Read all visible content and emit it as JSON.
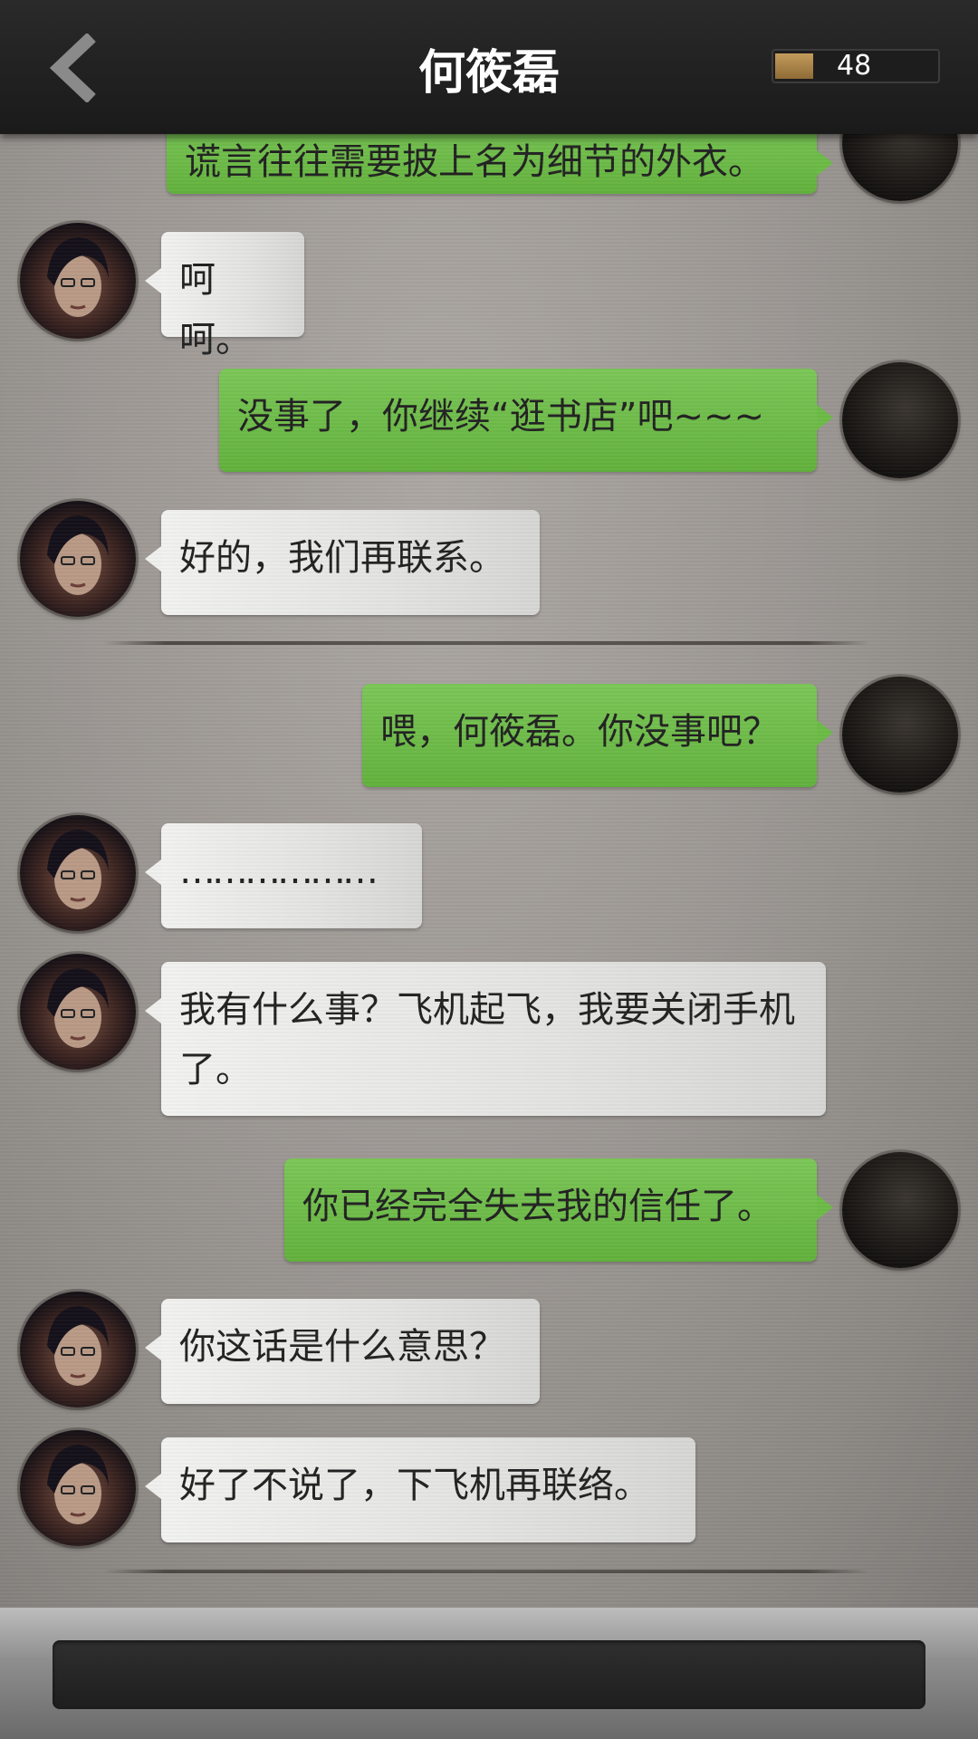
{
  "header": {
    "title": "何筱磊",
    "counter_value": "48"
  },
  "messages": [
    {
      "side": "out",
      "text": "谎言往往需要披上名为细节的外衣。"
    },
    {
      "side": "in",
      "text": "呵呵。"
    },
    {
      "side": "out",
      "text": "没事了，你继续“逛书店”吧~~~"
    },
    {
      "side": "in",
      "text": "好的，我们再联系。"
    },
    {
      "side": "out",
      "text": "喂，何筱磊。你没事吧？"
    },
    {
      "side": "in",
      "text": "………………"
    },
    {
      "side": "in",
      "text": "我有什么事？飞机起飞，我要关闭手机了。"
    },
    {
      "side": "out",
      "text": "你已经完全失去我的信任了。"
    },
    {
      "side": "in",
      "text": "你这话是什么意思？"
    },
    {
      "side": "in",
      "text": "好了不说了，下飞机再联络。"
    }
  ],
  "icons": {
    "back": "chevron-left-icon"
  },
  "colors": {
    "outgoing_bubble": "#6cbb47",
    "incoming_bubble": "#e8e8e6",
    "header": "#1f1f1f"
  }
}
